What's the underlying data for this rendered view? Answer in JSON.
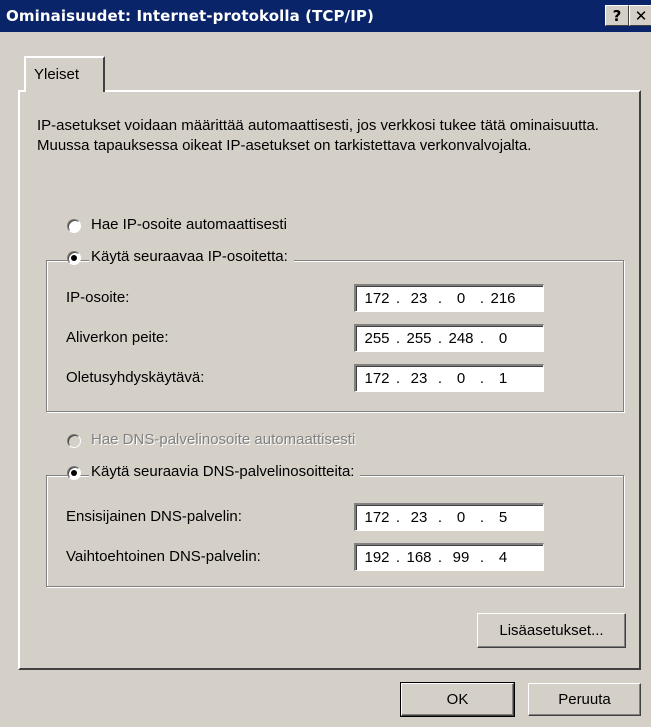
{
  "window": {
    "title": "Ominaisuudet: Internet-protokolla (TCP/IP)",
    "help_glyph": "?",
    "close_glyph": "✕"
  },
  "tabs": [
    {
      "label": "Yleiset",
      "selected": true
    }
  ],
  "description": "IP-asetukset voidaan määrittää automaattisesti, jos verkkosi tukee tätä ominaisuutta. Muussa tapauksessa oikeat IP-asetukset on tarkistettava verkonvalvojalta.",
  "ip": {
    "auto_label": "Hae IP-osoite automaattisesti",
    "manual_label": "Käytä seuraavaa IP-osoitetta:",
    "selected": "manual",
    "fields": [
      {
        "label": "IP-osoite:",
        "octets": [
          "172",
          "23",
          "0",
          "216"
        ]
      },
      {
        "label": "Aliverkon peite:",
        "octets": [
          "255",
          "255",
          "248",
          "0"
        ]
      },
      {
        "label": "Oletusyhdyskäytävä:",
        "octets": [
          "172",
          "23",
          "0",
          "1"
        ]
      }
    ]
  },
  "dns": {
    "auto_label": "Hae DNS-palvelinosoite automaattisesti",
    "auto_disabled": true,
    "manual_label": "Käytä seuraavia DNS-palvelinosoitteita:",
    "selected": "manual",
    "fields": [
      {
        "label": "Ensisijainen DNS-palvelin:",
        "octets": [
          "172",
          "23",
          "0",
          "5"
        ]
      },
      {
        "label": "Vaihtoehtoinen DNS-palvelin:",
        "octets": [
          "192",
          "168",
          "99",
          "4"
        ]
      }
    ]
  },
  "buttons": {
    "advanced": "Lisäasetukset...",
    "ok": "OK",
    "cancel": "Peruuta"
  }
}
